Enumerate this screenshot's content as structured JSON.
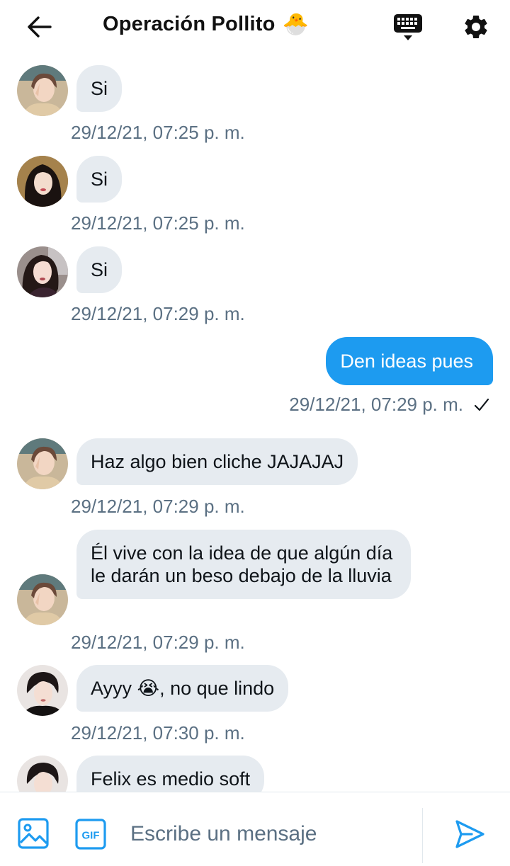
{
  "header": {
    "title": "Operación Pollito",
    "title_emoji": "🐣",
    "back_icon": "arrow-left-icon",
    "keyboard_icon": "keyboard-icon",
    "settings_icon": "gear-icon"
  },
  "messages": [
    {
      "from": "other",
      "avatar": "avatar-1",
      "text": "Si",
      "timestamp": "29/12/21, 07:25 p. m."
    },
    {
      "from": "other",
      "avatar": "avatar-2",
      "text": "Si",
      "timestamp": "29/12/21, 07:25 p. m."
    },
    {
      "from": "other",
      "avatar": "avatar-3",
      "text": "Si",
      "timestamp": "29/12/21, 07:29 p. m."
    },
    {
      "from": "me",
      "text": "Den ideas pues",
      "timestamp": "29/12/21, 07:29 p. m.",
      "status": "✓"
    },
    {
      "from": "other",
      "avatar": "avatar-1",
      "text": "Haz algo bien cliche JAJAJAJ",
      "timestamp": "29/12/21, 07:29 p. m."
    },
    {
      "from": "other",
      "avatar": "avatar-1",
      "text": "Él vive con la idea de que algún día le darán un beso debajo de la lluvia",
      "timestamp": "29/12/21, 07:29 p. m."
    },
    {
      "from": "other",
      "avatar": "avatar-4",
      "text": "Ayyy 😭, no que lindo",
      "timestamp": "29/12/21, 07:30 p. m."
    },
    {
      "from": "other",
      "avatar": "avatar-4",
      "text": "Felix es medio soft",
      "timestamp": ""
    }
  ],
  "composer": {
    "placeholder": "Escribe un mensaje",
    "gif_label": "GIF",
    "image_icon": "image-icon",
    "send_icon": "send-icon"
  },
  "colors": {
    "accent": "#1d9bf0",
    "bubble_in": "#e6ebf0",
    "muted_text": "#5b7083"
  }
}
